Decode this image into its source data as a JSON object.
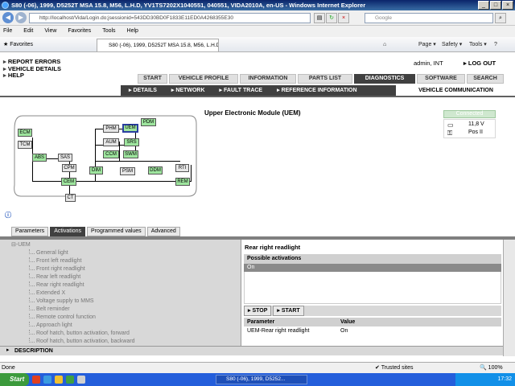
{
  "window": {
    "title": "S80 (-06), 1999, D5252T MSA 15.8, M56, L.H.D, YV1TS7202X1040551, 040551, VIDA2010A, en-US - Windows Internet Explorer",
    "min": "_",
    "max": "□",
    "close": "×"
  },
  "browser": {
    "address": "http://localhost/Vida/Login.do;jsessionid=543DD30BD0F1833E11ED0A4268355E30",
    "search_placeholder": "Google",
    "menu": [
      "File",
      "Edit",
      "View",
      "Favorites",
      "Tools",
      "Help"
    ],
    "favorites_label": "Favorites",
    "tab_title": "S80 (-06), 1999, D5252T MSA 15.8, M56, L.H.D, YV1...",
    "commands": {
      "page": "Page ▾",
      "safety": "Safety ▾",
      "tools": "Tools ▾",
      "help": "?"
    }
  },
  "header": {
    "left_links": [
      "REPORT ERRORS",
      "VEHICLE DETAILS",
      "HELP"
    ],
    "user": "admin, INT",
    "logout": "LOG OUT"
  },
  "main_tabs": [
    {
      "label": "START",
      "active": false
    },
    {
      "label": "VEHICLE PROFILE",
      "active": false
    },
    {
      "label": "INFORMATION",
      "active": false
    },
    {
      "label": "PARTS LIST",
      "active": false
    },
    {
      "label": "DIAGNOSTICS",
      "active": true
    },
    {
      "label": "SOFTWARE",
      "active": false
    },
    {
      "label": "SEARCH",
      "active": false
    }
  ],
  "sub_tabs": [
    "DETAILS",
    "NETWORK",
    "FAULT TRACE",
    "REFERENCE INFORMATION"
  ],
  "sub_active": "VEHICLE COMMUNICATION",
  "module": {
    "title": "Upper Electronic Module (UEM)",
    "connection": "Connected",
    "voltage": "11,8 V",
    "position": "Pos II"
  },
  "network_nodes": {
    "ecm": "ECM",
    "tcm": "TCM",
    "abs": "ABS",
    "sas": "SAS",
    "cpm": "CPM",
    "cem": "CEM",
    "ct": "CT",
    "phm": "PHM",
    "uem": "UEM",
    "pdm": "PDM",
    "aum": "AUM",
    "srs": "SRS",
    "ccm": "CCM",
    "swm": "SWM",
    "dim": "DIM",
    "psm": "PSM",
    "ddm": "DDM",
    "rti": "RTI",
    "rem": "REM"
  },
  "lower_tabs": [
    {
      "label": "Parameters",
      "active": false
    },
    {
      "label": "Activations",
      "active": true
    },
    {
      "label": "Programmed values",
      "active": false
    },
    {
      "label": "Advanced",
      "active": false
    }
  ],
  "tree": {
    "root": "UEM",
    "items": [
      "General light",
      "Front left readlight",
      "Front right readlight",
      "Rear left readlight",
      "Rear right readlight",
      "Extended X",
      "Voltage supply to MMS",
      "Belt reminder",
      "Remote control function",
      "Approach light",
      "Roof hatch, button activation, forward",
      "Roof hatch, button activation, backward"
    ]
  },
  "activation": {
    "name": "Rear right readlight",
    "possible_header": "Possible activations",
    "selected": "On",
    "stop": "STOP",
    "start": "START",
    "table_headers": [
      "Parameter",
      "Value"
    ],
    "rows": [
      {
        "parameter": "UEM-Rear right readlight",
        "value": "On"
      }
    ]
  },
  "description_label": "DESCRIPTION",
  "statusbar": {
    "left": "Done",
    "trusted": "Trusted sites",
    "zoom": "100%"
  },
  "taskbar": {
    "start": "Start",
    "item": "S80 (-06), 1999, D5252...",
    "time": "17:32"
  }
}
